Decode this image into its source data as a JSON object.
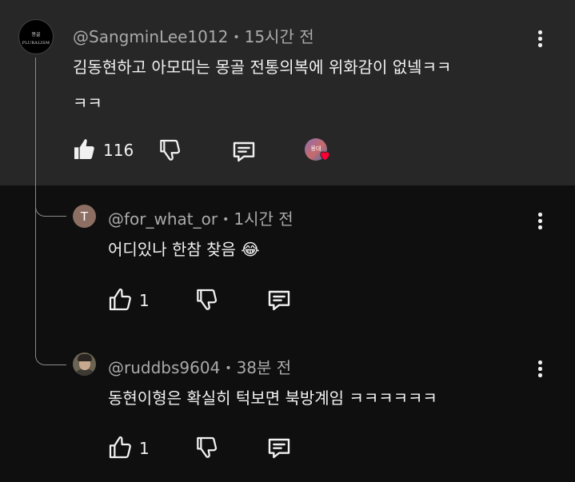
{
  "comments": [
    {
      "handle": "@SangminLee1012",
      "time": "15시간 전",
      "text_lines": [
        "김동현하고 아모띠는 몽골 전통의복에 위화감이 없넼ㅋㅋ",
        "ㅋㅋ"
      ],
      "likes": "116",
      "avatar_text_top": "몽골",
      "avatar_text_bottom": "PLURALISM",
      "creator_heart_avatar_text": "몽대"
    },
    {
      "handle": "@for_what_or",
      "time": "1시간 전",
      "text": "어디있나 한참 찾음 😂",
      "likes": "1",
      "avatar_letter": "T"
    },
    {
      "handle": "@ruddbs9604",
      "time": "38분 전",
      "text": "동현이형은 확실히 턱보면 북방계임 ㅋㅋㅋㅋㅋㅋ",
      "likes": "1"
    }
  ],
  "separator": "•",
  "colors": {
    "top_comment_bg": "#272727",
    "page_bg": "#0f0f0f",
    "text": "#f1f1f1",
    "meta": "#aaaaaa",
    "heart": "#ff0033"
  },
  "icons": [
    "like-icon",
    "dislike-icon",
    "reply-icon",
    "more-icon",
    "heart-icon"
  ]
}
